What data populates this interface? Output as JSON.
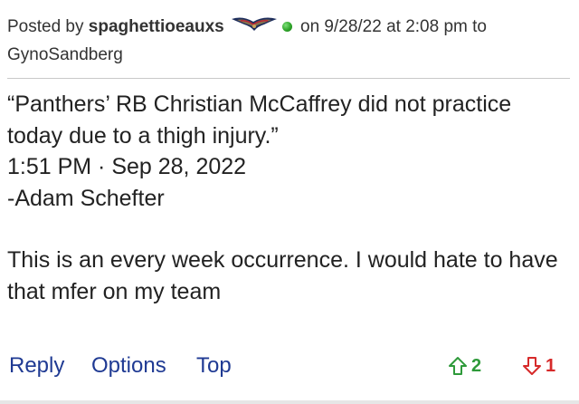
{
  "header": {
    "posted_by_label": "Posted by",
    "username": "spaghettioeauxs",
    "team_logo_icon": "pelicans-logo-icon",
    "online_icon": "online-status-icon",
    "online_color": "#2fa52a",
    "date_text": "on 9/28/22 at 2:08 pm to",
    "reply_to": "GynoSandberg"
  },
  "body": {
    "quote_line": "“Panthers’ RB Christian McCaffrey did not practice today due to a thigh injury.”",
    "timestamp": "1:51 PM · Sep 28, 2022",
    "attribution": "-Adam Schefter",
    "comment": "This is an every week occurrence. I would hate to have that mfer on my team"
  },
  "footer": {
    "reply_label": "Reply",
    "options_label": "Options",
    "top_label": "Top",
    "upvote_icon": "arrow-up-icon",
    "upvote_count": "2",
    "upvote_color": "#2e9a3a",
    "downvote_icon": "arrow-down-icon",
    "downvote_count": "1",
    "downvote_color": "#d62a2a",
    "link_color": "#1f3a93"
  }
}
